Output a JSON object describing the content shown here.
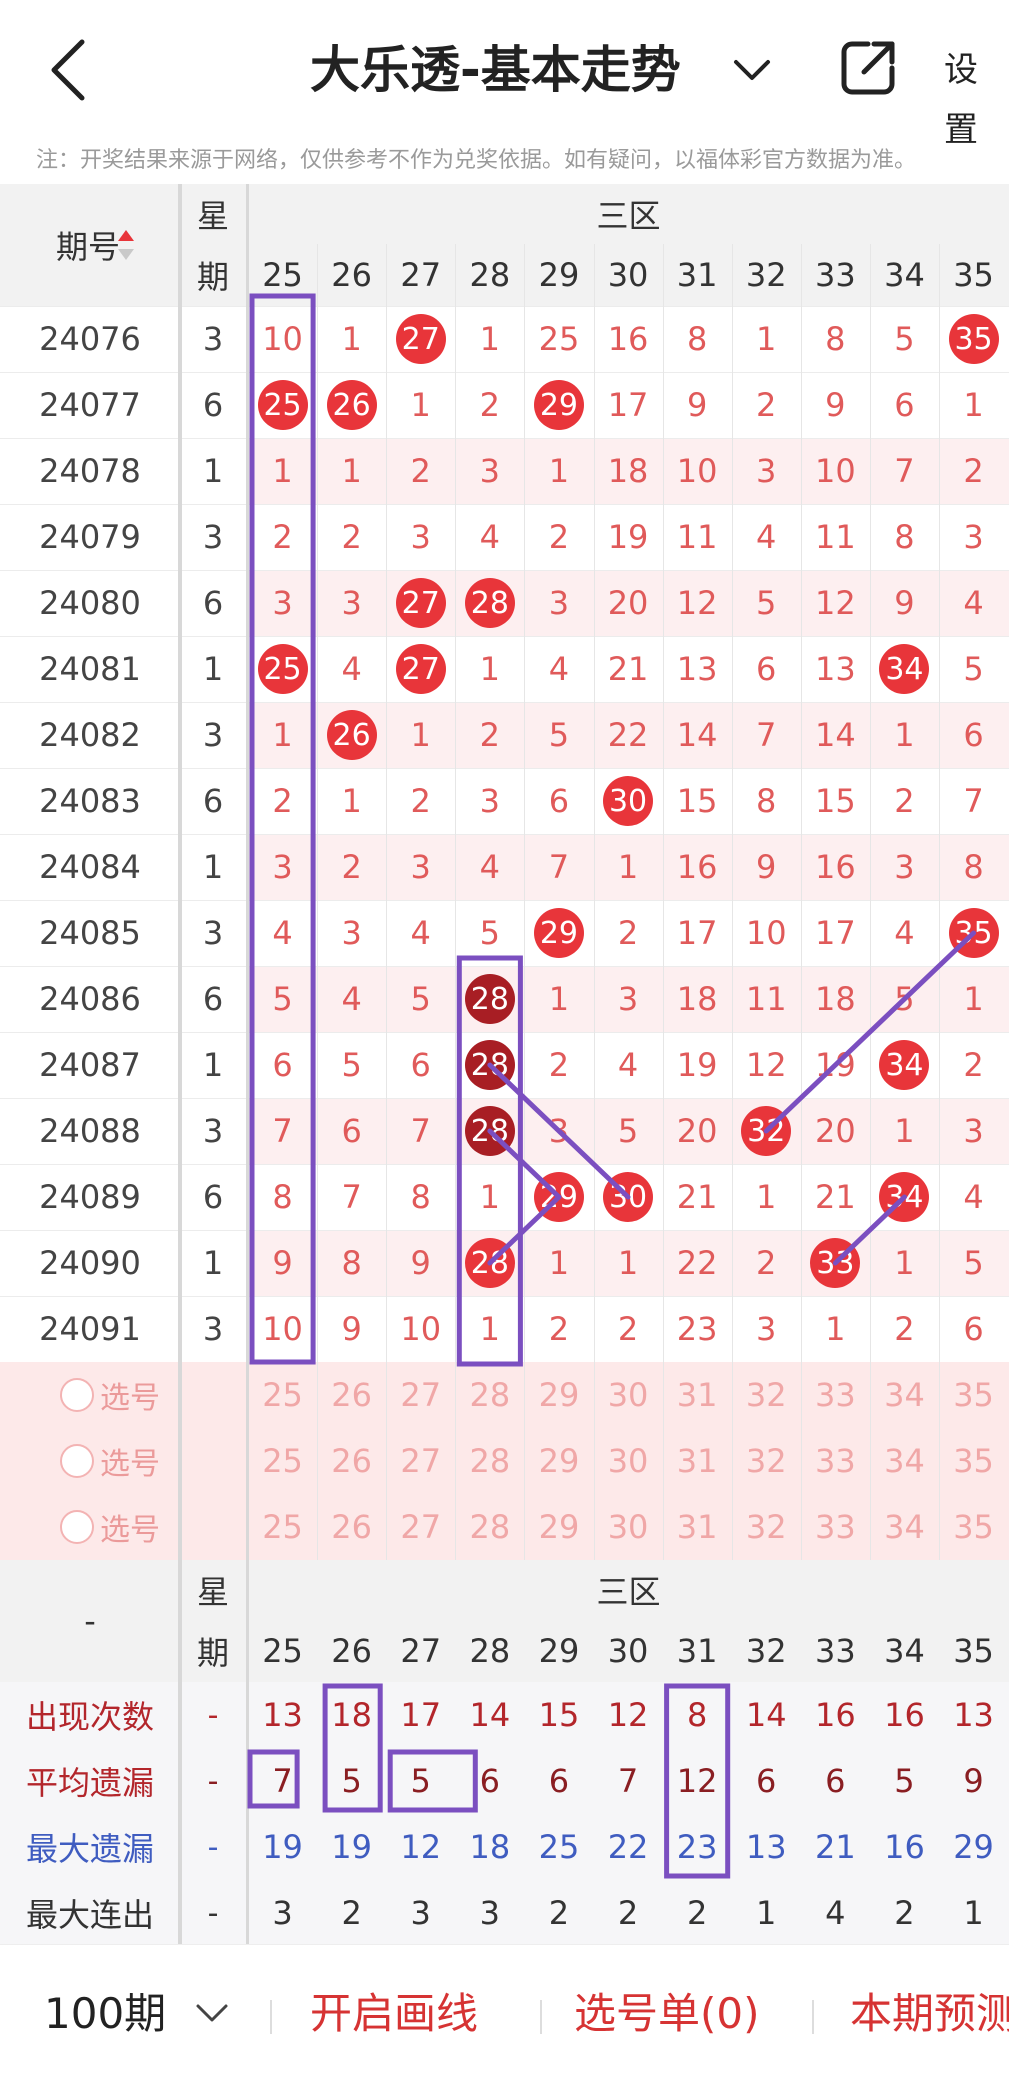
{
  "header": {
    "title": "大乐透-基本走势",
    "settings_label": "设置",
    "back_icon": "back-arrow-icon",
    "share_icon": "share-icon"
  },
  "notice": "注：开奖结果来源于网络，仅供参考不作为兑奖依据。如有疑问，以福体彩官方数据为准。",
  "table": {
    "col_issue": "期号",
    "col_week": "星期",
    "zone_label": "三区",
    "numbers": [
      25,
      26,
      27,
      28,
      29,
      30,
      31,
      32,
      33,
      34,
      35
    ],
    "rows": [
      {
        "issue": "24076",
        "week": "3",
        "cells": [
          10,
          1,
          27,
          1,
          25,
          16,
          8,
          1,
          8,
          5,
          35
        ],
        "hits": [
          27,
          35
        ]
      },
      {
        "issue": "24077",
        "week": "6",
        "cells": [
          25,
          26,
          1,
          2,
          29,
          17,
          9,
          2,
          9,
          6,
          1
        ],
        "hits": [
          25,
          26,
          29
        ]
      },
      {
        "issue": "24078",
        "week": "1",
        "cells": [
          1,
          1,
          2,
          3,
          1,
          18,
          10,
          3,
          10,
          7,
          2
        ],
        "hits": []
      },
      {
        "issue": "24079",
        "week": "3",
        "cells": [
          2,
          2,
          3,
          4,
          2,
          19,
          11,
          4,
          11,
          8,
          3
        ],
        "hits": []
      },
      {
        "issue": "24080",
        "week": "6",
        "cells": [
          3,
          3,
          27,
          28,
          3,
          20,
          12,
          5,
          12,
          9,
          4
        ],
        "hits": [
          27,
          28
        ]
      },
      {
        "issue": "24081",
        "week": "1",
        "cells": [
          25,
          4,
          27,
          1,
          4,
          21,
          13,
          6,
          13,
          34,
          5
        ],
        "hits": [
          25,
          27,
          34
        ]
      },
      {
        "issue": "24082",
        "week": "3",
        "cells": [
          1,
          26,
          1,
          2,
          5,
          22,
          14,
          7,
          14,
          1,
          6
        ],
        "hits": [
          26
        ]
      },
      {
        "issue": "24083",
        "week": "6",
        "cells": [
          2,
          1,
          2,
          3,
          6,
          30,
          15,
          8,
          15,
          2,
          7
        ],
        "hits": [
          30
        ]
      },
      {
        "issue": "24084",
        "week": "1",
        "cells": [
          3,
          2,
          3,
          4,
          7,
          1,
          16,
          9,
          16,
          3,
          8
        ],
        "hits": []
      },
      {
        "issue": "24085",
        "week": "3",
        "cells": [
          4,
          3,
          4,
          5,
          29,
          2,
          17,
          10,
          17,
          4,
          35
        ],
        "hits": [
          29,
          35
        ]
      },
      {
        "issue": "24086",
        "week": "6",
        "cells": [
          5,
          4,
          5,
          28,
          1,
          3,
          18,
          11,
          18,
          5,
          1
        ],
        "hits": [
          28
        ]
      },
      {
        "issue": "24087",
        "week": "1",
        "cells": [
          6,
          5,
          6,
          28,
          2,
          4,
          19,
          12,
          19,
          34,
          2
        ],
        "hits": [
          28,
          34
        ]
      },
      {
        "issue": "24088",
        "week": "3",
        "cells": [
          7,
          6,
          7,
          28,
          3,
          5,
          20,
          32,
          20,
          1,
          3
        ],
        "hits": [
          28,
          32
        ]
      },
      {
        "issue": "24089",
        "week": "6",
        "cells": [
          8,
          7,
          8,
          1,
          29,
          30,
          21,
          1,
          21,
          34,
          4
        ],
        "hits": [
          29,
          30,
          34
        ]
      },
      {
        "issue": "24090",
        "week": "1",
        "cells": [
          9,
          8,
          9,
          28,
          1,
          1,
          22,
          2,
          33,
          1,
          5
        ],
        "hits": [
          28,
          33
        ]
      },
      {
        "issue": "24091",
        "week": "3",
        "cells": [
          10,
          9,
          10,
          1,
          2,
          2,
          23,
          3,
          1,
          2,
          6
        ],
        "hits": []
      }
    ],
    "select_label": "选号",
    "select_rows": 3
  },
  "stats": {
    "corner": "-",
    "col_week": "星期",
    "zone_label": "三区",
    "numbers": [
      25,
      26,
      27,
      28,
      29,
      30,
      31,
      32,
      33,
      34,
      35
    ],
    "rows": [
      {
        "label": "出现次数",
        "dash": "-",
        "values": [
          13,
          18,
          17,
          14,
          15,
          12,
          8,
          14,
          16,
          16,
          13
        ]
      },
      {
        "label": "平均遗漏",
        "dash": "-",
        "values": [
          7,
          5,
          5,
          6,
          6,
          7,
          12,
          6,
          6,
          5,
          9
        ]
      },
      {
        "label": "最大遗漏",
        "dash": "-",
        "values": [
          19,
          19,
          12,
          18,
          25,
          22,
          23,
          13,
          21,
          16,
          29
        ]
      },
      {
        "label": "最大连出",
        "dash": "-",
        "values": [
          3,
          2,
          3,
          3,
          2,
          2,
          2,
          1,
          4,
          2,
          1
        ]
      }
    ]
  },
  "bottom": {
    "periods": "100期",
    "draw_lines": "开启画线",
    "pick_list": "选号单(0)",
    "predict": "本期预测"
  },
  "colors": {
    "hit": "#e8353a",
    "hit_dark": "#a81e24",
    "annotation": "#7b4fc0",
    "accent_red": "#d63333",
    "blue": "#3f5cc0"
  }
}
